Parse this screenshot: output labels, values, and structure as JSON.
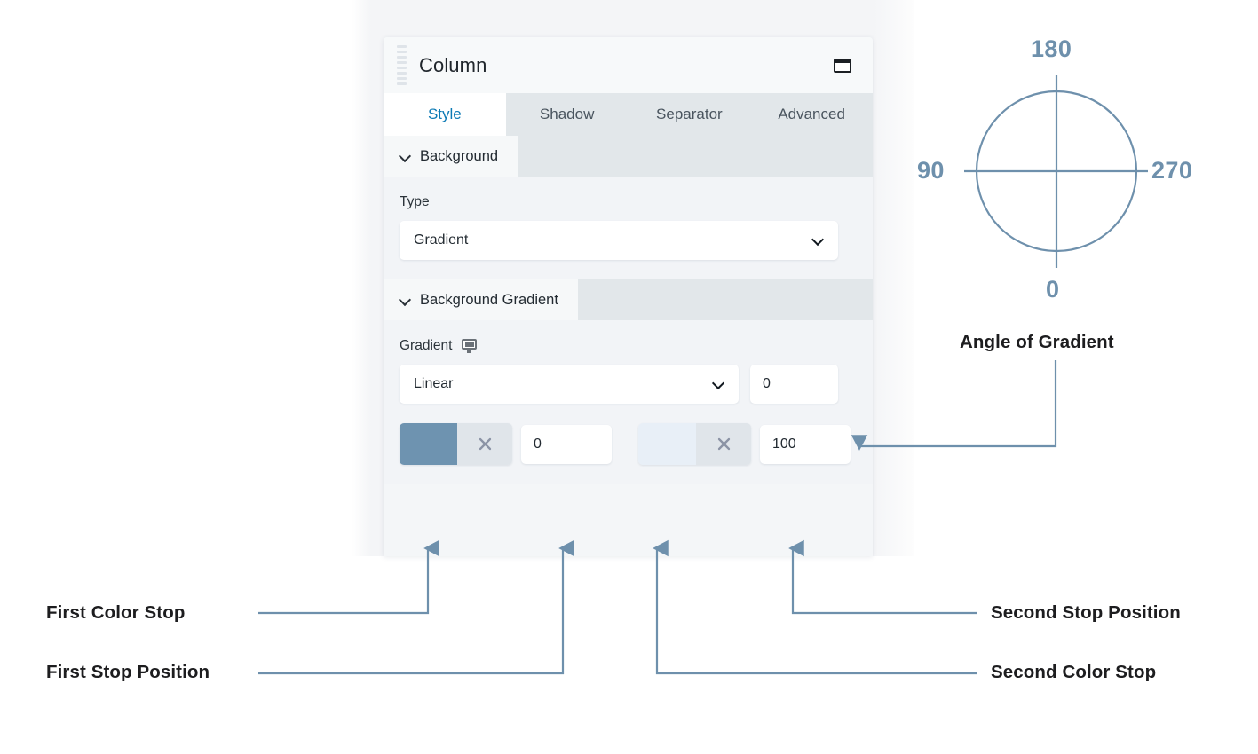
{
  "panel": {
    "title": "Column",
    "drag_handle_icon": "drag-handle-icon",
    "window_icon": "window-layout-icon",
    "tabs": [
      {
        "label": "Style",
        "active": true
      },
      {
        "label": "Shadow",
        "active": false
      },
      {
        "label": "Separator",
        "active": false
      },
      {
        "label": "Advanced",
        "active": false
      }
    ],
    "sections": [
      {
        "title": "Background",
        "expanded": true,
        "fields": [
          {
            "label": "Type",
            "control": "select",
            "value": "Gradient",
            "caret_icon": "chevron-down-icon"
          }
        ]
      },
      {
        "title": "Background Gradient",
        "expanded": true,
        "fields": [
          {
            "label": "Gradient",
            "label_icon": "monitor-icon",
            "control": "select",
            "value": "Linear",
            "caret_icon": "chevron-down-icon"
          }
        ],
        "angle_value": "0",
        "stops": [
          {
            "color": "#6e93b0",
            "clear_icon": "close-icon",
            "position": "0"
          },
          {
            "color": "#e8eff7",
            "clear_icon": "close-icon",
            "position": "100"
          }
        ]
      }
    ]
  },
  "dial": {
    "caption": "Angle of Gradient",
    "labels": {
      "top": "180",
      "bottom": "0",
      "left": "90",
      "right": "270"
    },
    "stroke_color": "#6e90ac"
  },
  "annotations": {
    "first_color_stop": "First Color Stop",
    "first_stop_position": "First Stop Position",
    "second_stop_position": "Second Stop Position",
    "second_color_stop": "Second Color Stop",
    "connector_color": "#6e90ac"
  },
  "colors": {
    "accent_blue": "#0c7ab5",
    "panel_bg": "#f2f4f7",
    "tab_bar_bg": "#e2e7ea",
    "text_dark": "#1d1d1f"
  }
}
